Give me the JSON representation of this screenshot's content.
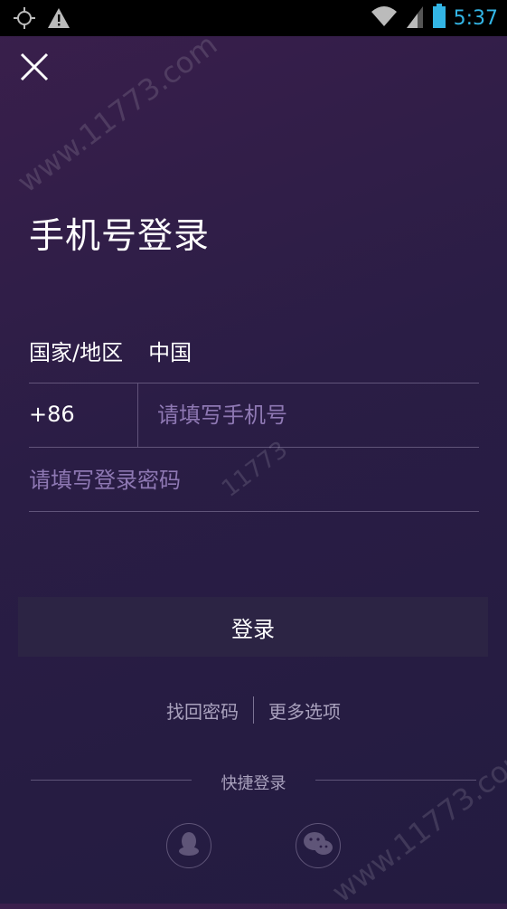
{
  "status_bar": {
    "time": "5:37",
    "left_icons": [
      "gps-icon",
      "warning-icon"
    ],
    "right_icons": [
      "wifi-icon",
      "signal-icon",
      "battery-icon"
    ],
    "time_color": "#33b5e5"
  },
  "close_icon": "close-icon",
  "title": "手机号登录",
  "country": {
    "label": "国家/地区",
    "value": "中国"
  },
  "phone": {
    "country_code": "+86",
    "placeholder": "请填写手机号"
  },
  "password": {
    "placeholder": "请填写登录密码"
  },
  "login_button": "登录",
  "links": {
    "forgot_password": "找回密码",
    "more_options": "更多选项"
  },
  "quick_login": {
    "label": "快捷登录",
    "providers": [
      "qq-icon",
      "wechat-icon"
    ]
  },
  "watermark": "www.11773.com",
  "watermark_center": "11773",
  "colors": {
    "background_top": "#3a1f4c",
    "background_bottom": "#231b40",
    "placeholder": "#8e78b3",
    "button_bg": "#2c2444",
    "muted_text": "#a9a1bd"
  }
}
